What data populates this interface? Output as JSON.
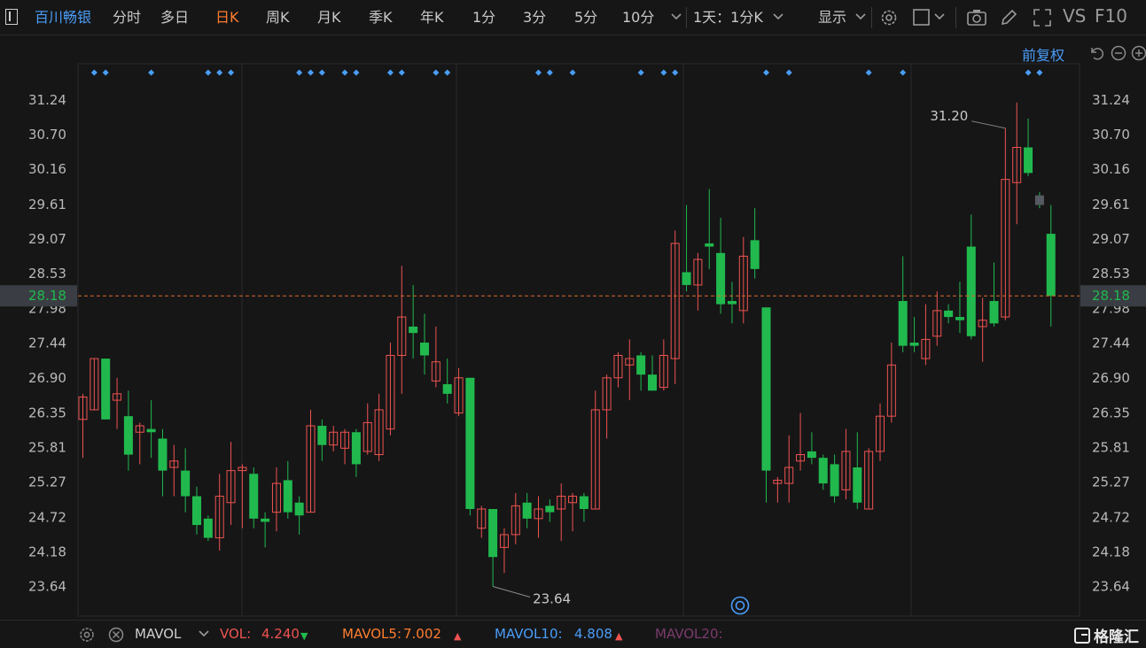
{
  "toolbar": {
    "stock_name": "百川畅银",
    "periods": [
      "分时",
      "多日",
      "日K",
      "周K",
      "月K",
      "季K",
      "年K",
      "1分",
      "3分",
      "5分",
      "10分"
    ],
    "active_period": "日K",
    "interval_select": "1天：1分K",
    "display_label": "显示",
    "vs_label": "VS",
    "f10_label": "F10",
    "icons": [
      "gear-icon",
      "square-icon",
      "camera-icon",
      "pencil-icon",
      "fullscreen-icon"
    ]
  },
  "subbar": {
    "adjust_label": "前复权"
  },
  "colors": {
    "background": "#161617",
    "up": "#ef5350",
    "down": "#21b94e",
    "accent": "#ff7d2e",
    "link": "#4a9df8",
    "grid": "#2a2a2c",
    "price_line": "#e0682a"
  },
  "chart_data": {
    "type": "candlestick",
    "y_ticks": [
      "31.24",
      "30.70",
      "30.16",
      "29.61",
      "29.07",
      "28.53",
      "27.98",
      "27.44",
      "26.90",
      "26.35",
      "25.81",
      "25.27",
      "24.72",
      "24.18",
      "23.64"
    ],
    "ylim": [
      23.36,
      31.56
    ],
    "current_price": "28.18",
    "high_label": "31.20",
    "high_index": 81,
    "low_label": "23.64",
    "low_index": 36,
    "event_marker_indices": [
      1,
      2,
      6,
      11,
      12,
      13,
      19,
      20,
      21,
      23,
      24,
      27,
      28,
      31,
      32,
      40,
      41,
      43,
      49,
      51,
      52,
      60,
      62,
      69,
      72,
      83,
      84
    ],
    "candles": [
      {
        "o": 26.25,
        "c": 26.6,
        "h": 26.65,
        "l": 25.65
      },
      {
        "o": 26.4,
        "c": 27.2,
        "h": 27.2,
        "l": 26.4
      },
      {
        "o": 27.2,
        "c": 26.25,
        "h": 27.2,
        "l": 26.25
      },
      {
        "o": 26.55,
        "c": 26.65,
        "h": 26.9,
        "l": 26.1
      },
      {
        "o": 26.3,
        "c": 25.7,
        "h": 26.7,
        "l": 25.45
      },
      {
        "o": 26.05,
        "c": 26.15,
        "h": 26.2,
        "l": 25.55
      },
      {
        "o": 26.1,
        "c": 26.05,
        "h": 26.55,
        "l": 25.65
      },
      {
        "o": 25.95,
        "c": 25.45,
        "h": 26.1,
        "l": 25.05
      },
      {
        "o": 25.5,
        "c": 25.6,
        "h": 25.85,
        "l": 25.05
      },
      {
        "o": 25.45,
        "c": 25.05,
        "h": 25.8,
        "l": 24.8
      },
      {
        "o": 25.05,
        "c": 24.6,
        "h": 25.2,
        "l": 24.45
      },
      {
        "o": 24.7,
        "c": 24.4,
        "h": 24.75,
        "l": 24.35
      },
      {
        "o": 24.4,
        "c": 25.05,
        "h": 25.4,
        "l": 24.2
      },
      {
        "o": 24.95,
        "c": 25.45,
        "h": 25.9,
        "l": 24.6
      },
      {
        "o": 25.45,
        "c": 25.5,
        "h": 25.55,
        "l": 24.55
      },
      {
        "o": 25.4,
        "c": 24.7,
        "h": 25.5,
        "l": 24.55
      },
      {
        "o": 24.7,
        "c": 24.65,
        "h": 24.8,
        "l": 24.25
      },
      {
        "o": 24.8,
        "c": 25.25,
        "h": 25.5,
        "l": 24.5
      },
      {
        "o": 25.3,
        "c": 24.8,
        "h": 25.6,
        "l": 24.7
      },
      {
        "o": 24.95,
        "c": 24.75,
        "h": 25.05,
        "l": 24.45
      },
      {
        "o": 24.8,
        "c": 26.15,
        "h": 26.4,
        "l": 24.8
      },
      {
        "o": 26.15,
        "c": 25.85,
        "h": 26.25,
        "l": 25.6
      },
      {
        "o": 25.85,
        "c": 26.05,
        "h": 26.15,
        "l": 25.75
      },
      {
        "o": 25.8,
        "c": 26.05,
        "h": 26.1,
        "l": 25.55
      },
      {
        "o": 26.05,
        "c": 25.55,
        "h": 26.1,
        "l": 25.35
      },
      {
        "o": 25.75,
        "c": 26.2,
        "h": 26.5,
        "l": 25.7
      },
      {
        "o": 25.7,
        "c": 26.4,
        "h": 26.65,
        "l": 25.6
      },
      {
        "o": 26.1,
        "c": 27.25,
        "h": 27.45,
        "l": 26.0
      },
      {
        "o": 27.25,
        "c": 27.85,
        "h": 28.65,
        "l": 26.65
      },
      {
        "o": 27.7,
        "c": 27.6,
        "h": 28.35,
        "l": 27.2
      },
      {
        "o": 27.45,
        "c": 27.25,
        "h": 27.9,
        "l": 26.95
      },
      {
        "o": 26.85,
        "c": 27.15,
        "h": 27.7,
        "l": 26.75
      },
      {
        "o": 26.8,
        "c": 26.65,
        "h": 27.2,
        "l": 26.5
      },
      {
        "o": 26.35,
        "c": 26.9,
        "h": 27.05,
        "l": 26.3
      },
      {
        "o": 26.9,
        "c": 24.85,
        "h": 26.9,
        "l": 24.75
      },
      {
        "o": 24.55,
        "c": 24.85,
        "h": 24.9,
        "l": 24.4
      },
      {
        "o": 24.85,
        "c": 24.1,
        "h": 24.85,
        "l": 23.64
      },
      {
        "o": 24.25,
        "c": 24.45,
        "h": 24.55,
        "l": 23.85
      },
      {
        "o": 24.45,
        "c": 24.9,
        "h": 25.1,
        "l": 24.3
      },
      {
        "o": 24.95,
        "c": 24.7,
        "h": 25.1,
        "l": 24.55
      },
      {
        "o": 24.7,
        "c": 24.85,
        "h": 25.05,
        "l": 24.4
      },
      {
        "o": 24.9,
        "c": 24.8,
        "h": 25.0,
        "l": 24.65
      },
      {
        "o": 24.85,
        "c": 25.05,
        "h": 25.25,
        "l": 24.35
      },
      {
        "o": 24.95,
        "c": 25.05,
        "h": 25.1,
        "l": 24.5
      },
      {
        "o": 25.05,
        "c": 24.85,
        "h": 25.1,
        "l": 24.65
      },
      {
        "o": 24.85,
        "c": 26.4,
        "h": 26.7,
        "l": 24.85
      },
      {
        "o": 26.4,
        "c": 26.9,
        "h": 26.95,
        "l": 25.95
      },
      {
        "o": 26.9,
        "c": 27.25,
        "h": 27.3,
        "l": 26.75
      },
      {
        "o": 27.1,
        "c": 27.2,
        "h": 27.5,
        "l": 26.55
      },
      {
        "o": 27.25,
        "c": 26.95,
        "h": 27.3,
        "l": 26.7
      },
      {
        "o": 26.95,
        "c": 26.7,
        "h": 27.25,
        "l": 26.7
      },
      {
        "o": 26.75,
        "c": 27.25,
        "h": 27.5,
        "l": 26.7
      },
      {
        "o": 27.2,
        "c": 29.0,
        "h": 29.2,
        "l": 26.8
      },
      {
        "o": 28.55,
        "c": 28.35,
        "h": 29.6,
        "l": 28.25
      },
      {
        "o": 28.35,
        "c": 28.75,
        "h": 28.85,
        "l": 27.95
      },
      {
        "o": 29.0,
        "c": 28.95,
        "h": 29.85,
        "l": 28.6
      },
      {
        "o": 28.85,
        "c": 28.05,
        "h": 29.4,
        "l": 27.9
      },
      {
        "o": 28.1,
        "c": 28.05,
        "h": 28.4,
        "l": 27.75
      },
      {
        "o": 27.95,
        "c": 28.8,
        "h": 29.1,
        "l": 27.75
      },
      {
        "o": 29.05,
        "c": 28.6,
        "h": 29.55,
        "l": 28.45
      },
      {
        "o": 28.0,
        "c": 25.45,
        "h": 28.0,
        "l": 24.95
      },
      {
        "o": 25.25,
        "c": 25.3,
        "h": 25.35,
        "l": 24.95
      },
      {
        "o": 25.25,
        "c": 25.5,
        "h": 26.0,
        "l": 24.95
      },
      {
        "o": 25.6,
        "c": 25.7,
        "h": 26.35,
        "l": 25.45
      },
      {
        "o": 25.75,
        "c": 25.65,
        "h": 26.05,
        "l": 25.55
      },
      {
        "o": 25.65,
        "c": 25.25,
        "h": 25.7,
        "l": 25.15
      },
      {
        "o": 25.55,
        "c": 25.05,
        "h": 25.7,
        "l": 24.95
      },
      {
        "o": 25.15,
        "c": 25.75,
        "h": 26.1,
        "l": 25.0
      },
      {
        "o": 25.5,
        "c": 24.95,
        "h": 26.05,
        "l": 24.85
      },
      {
        "o": 24.85,
        "c": 25.75,
        "h": 25.8,
        "l": 24.85
      },
      {
        "o": 25.75,
        "c": 26.3,
        "h": 26.5,
        "l": 25.6
      },
      {
        "o": 26.3,
        "c": 27.1,
        "h": 27.45,
        "l": 26.2
      },
      {
        "o": 28.1,
        "c": 27.4,
        "h": 28.8,
        "l": 27.3
      },
      {
        "o": 27.45,
        "c": 27.4,
        "h": 27.85,
        "l": 27.3
      },
      {
        "o": 27.2,
        "c": 27.5,
        "h": 28.05,
        "l": 27.1
      },
      {
        "o": 27.55,
        "c": 27.95,
        "h": 28.25,
        "l": 27.4
      },
      {
        "o": 27.95,
        "c": 27.85,
        "h": 28.05,
        "l": 27.75
      },
      {
        "o": 27.85,
        "c": 27.8,
        "h": 28.4,
        "l": 27.6
      },
      {
        "o": 28.95,
        "c": 27.55,
        "h": 29.45,
        "l": 27.5
      },
      {
        "o": 27.7,
        "c": 27.8,
        "h": 28.15,
        "l": 27.15
      },
      {
        "o": 28.1,
        "c": 27.75,
        "h": 28.7,
        "l": 27.7
      },
      {
        "o": 27.85,
        "c": 30.0,
        "h": 30.8,
        "l": 27.8
      },
      {
        "o": 29.95,
        "c": 30.5,
        "h": 31.2,
        "l": 29.3
      },
      {
        "o": 30.5,
        "c": 30.1,
        "h": 30.95,
        "l": 30.05
      },
      {
        "o": 29.75,
        "c": 29.6,
        "h": 29.8,
        "l": 29.55
      },
      {
        "o": 29.15,
        "c": 28.18,
        "h": 29.6,
        "l": 27.7
      }
    ]
  },
  "bottombar": {
    "indicator_name": "MAVOL",
    "vol_label": "VOL:",
    "vol_value": "4.240",
    "vol_arrow": "▼",
    "mavol5_label": "MAVOL5:",
    "mavol5_value": "7.002",
    "mavol5_arrow": "▲",
    "mavol10_label": "MAVOL10:",
    "mavol10_value": "4.808",
    "mavol10_arrow": "▲",
    "mavol20_label": "MAVOL20:",
    "brand": "格隆汇"
  }
}
